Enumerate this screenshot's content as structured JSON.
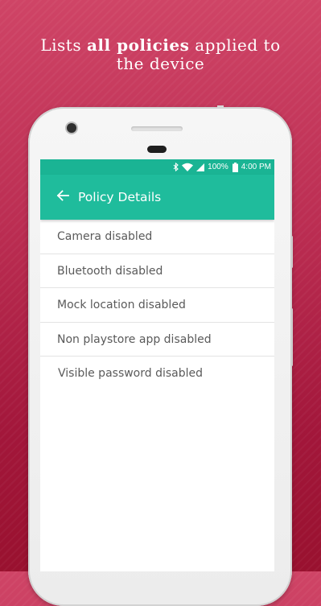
{
  "headline": {
    "prefix": "Lists ",
    "bold": "all policies",
    "suffix": " applied to",
    "line2": "the device"
  },
  "status_bar": {
    "icons": [
      "bluetooth-icon",
      "wifi-icon",
      "cell-signal-icon",
      "battery-icon"
    ],
    "battery": "100%",
    "time": "4:00 PM"
  },
  "toolbar": {
    "back_icon": "arrow-back-icon",
    "title": "Policy Details"
  },
  "policies": [
    "Camera disabled",
    "Bluetooth disabled",
    "Mock location disabled",
    "Non playstore app disabled",
    "Visible password disabled"
  ],
  "colors": {
    "background": "#b8284e",
    "accent": "#1fbc9c",
    "status_bar": "#1ab494",
    "list_text": "#5a5a5a"
  }
}
